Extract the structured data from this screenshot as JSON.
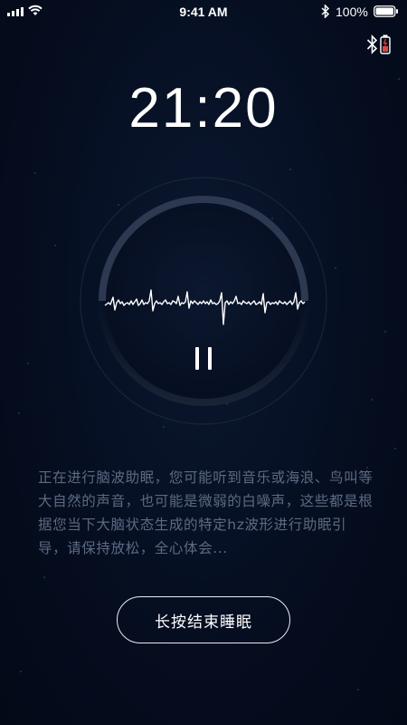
{
  "status_bar": {
    "time": "9:41 AM",
    "battery_percent": "100%",
    "signal_icon": "cellular-signal-icon",
    "wifi_icon": "wifi-icon",
    "bluetooth_icon": "bluetooth-icon",
    "battery_icon": "battery-icon"
  },
  "device_status": {
    "bluetooth_icon": "bluetooth-icon",
    "battery_icon": "low-battery-icon",
    "battery_color": "#e0463c"
  },
  "timer": {
    "display": "21:20",
    "progress_fraction": 0.5
  },
  "player": {
    "state_icon": "pause-icon",
    "waveform_icon": "waveform-icon"
  },
  "description": "正在进行脑波助眠，您可能听到音乐或海浪、鸟叫等大自然的声音，也可能是微弱的白噪声，这些都是根据您当下大脑状态生成的特定hz波形进行助眠引导，请保持放松，全心体会...",
  "end_button": {
    "label": "长按结束睡眠"
  },
  "colors": {
    "background": "#050d1f",
    "text_primary": "#ffffff",
    "text_secondary": "#5c6a82",
    "dial_track": "#2d3950"
  }
}
